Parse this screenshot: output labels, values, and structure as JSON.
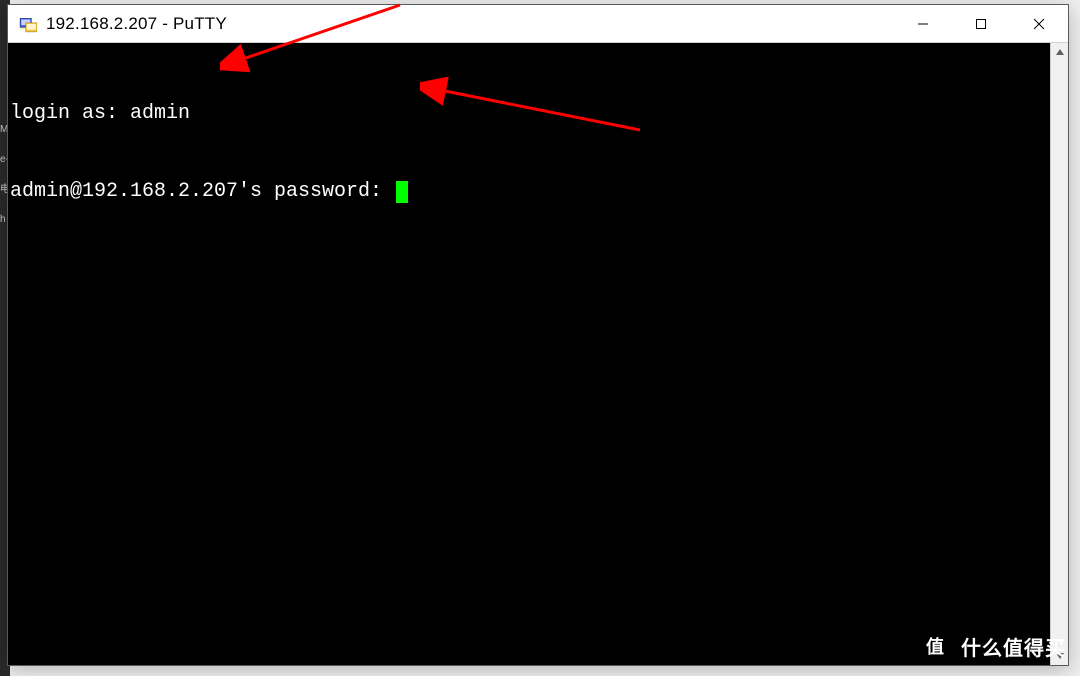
{
  "window": {
    "title": "192.168.2.207 - PuTTY"
  },
  "terminal": {
    "line1": "login as: admin",
    "line2": "admin@192.168.2.207's password: "
  },
  "background_labels": {
    "l1": "MB",
    "l2": "e-",
    "l3": "电",
    "l4": "h"
  },
  "watermark": {
    "badge": "值",
    "text": "什么值得买"
  }
}
